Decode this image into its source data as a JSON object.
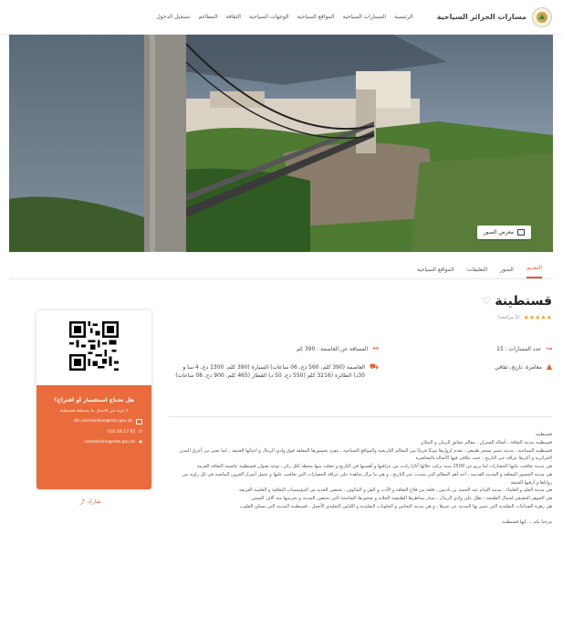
{
  "header": {
    "brand": "مسارات الجزائر السياحية",
    "nav": [
      "الرئيسية",
      "المسارات السياحية",
      "المواقع السياحية",
      "الوجهات السياحية",
      "الثقافة",
      "المطاعم",
      "تسجيل الدخول"
    ]
  },
  "hero": {
    "gallery_label": "معرض الصور"
  },
  "tabs": [
    "التقديم",
    "الصور",
    "التعليقات",
    "المواقع السياحية"
  ],
  "place": {
    "title": "قسنطينة",
    "stars": "★★★★★",
    "rating_count": "(1 مراجعة)",
    "paths_count": "عدد المسارات : 15",
    "categories": "مغامرة، تاريخ، ثقافي",
    "distance": "المسافة عن العاصمة : 390 كم",
    "travel": "العاصمة (390 كلم، 560 دج، 06 ساعات) السيارة (390 كلم، 1300 دج، 4 سا و 30د) الطائرة (3216 كلم (550 دج، 50 د) القطار (465 كلم، 900 دج، 08 ساعات)"
  },
  "description": {
    "paragraphs": [
      "قسنطينة",
      "قسنطينة مدينة الثقافة ، أصالة العمران ، معالم تتعانق الزمان و المكان",
      "قسنطينة السياحية ، مدينة تتميز بسحر طبيعي ، تقدم لزوارها تنوعًا فريدًا من المعالم التاريخية والمواقع السياحية ، تنفرد بجسورها المعلقة فوق وادي الرمال و أحيائها العتيقة ، كما تعتبر من أعرق المدن الجزائرية و أكثرها عراقة عبر التاريخ ، حيث تتلاقى فيها الأصالة بالمعاصرة",
      "هي مدينة تعاقبت عليها الحضارات لما يربو عن 2500 سنة تركت خلالها آثارًا زادت من عراقتها و أهميتها في التاريخ و جعلت منها محطة لكل زائر ، توجد بعنوان قسنطينة عاصمة الثقافة العربية",
      "هي مدينة الجسور المعلقة و المدينة القديمة ، أحد أهم المعالم التي شيدت عبر التاريخ ، و هي ما تزال شاهدة على عراقة الحضارات التي تعاقبت عليها و تحمل أسرار القرون الماضية في كل زاوية من زواياها و أزقتها العتيقة",
      "هي مدينة العلم و العلماء ، مدينة الإمام عبد الحميد بن باديس ، قلعة من قلاع الثقافة و الأدب و الفن و المالوف ، تحتضن العديد من المؤسسات الثقافية و العلمية العريقة",
      "هي الجوهر الحقيقي لجمال الطبيعة ، تطل على وادي الرمال ، تمتاز بمناظرها الطبيعية الخلابة و صخورها الشامخة التي تحتضن المدينة و تحرسها منذ آلاف السنين",
      "هي زهرة الصناعات التقليدية التي تتميز بها المدينة عن غيرها ، و هي مدينة النحاس و الحلويات التقليدية و اللباس التقليدي الأصيل ، قسنطينة المدينة التي تسكن القلوب"
    ],
    "closing": "مرحبا بكم ... إنها قسنطينة"
  },
  "card": {
    "question": "هل تحتاج استفسار أو اقتراح؟",
    "subtitle": "لا تتردد في الاتصال بنا بمصلحة قسنطينة",
    "email": "dtc.constantine@mta.gov.dz",
    "phone": "031 64 17 65",
    "web": "constantine@mta.gov.dz",
    "share": "شارك"
  },
  "colors": {
    "accent": "#e35b2b",
    "card": "#ea6c3c"
  }
}
